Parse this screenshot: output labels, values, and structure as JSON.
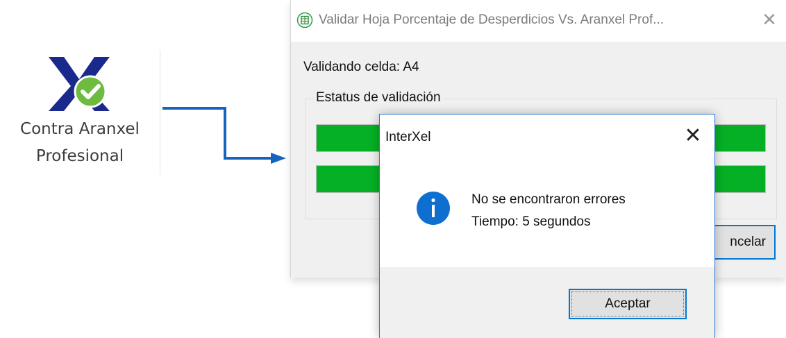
{
  "ribbon": {
    "button_line1": "Contra Aranxel",
    "button_line2": "Profesional",
    "icon": "aranxel-check-logo"
  },
  "validation_window": {
    "title": "Validar Hoja Porcentaje de Desperdicios Vs. Aranxel Prof...",
    "close_symbol": "✕",
    "status_text": "Validando celda: A4",
    "group_title": "Estatus de validación",
    "progress_1": 1.0,
    "progress_2": 1.0,
    "cancel_label": "ncelar"
  },
  "message_box": {
    "title": "InterXel",
    "close_symbol": "✕",
    "icon": "info-icon",
    "line1": "No se encontraron errores",
    "line2": "Tiempo: 5 segundos",
    "ok_label": "Aceptar"
  },
  "colors": {
    "progress_fill": "#06b025",
    "accent_blue": "#0078d7",
    "arrow_blue": "#1565c0",
    "logo_blue": "#1a2a8c",
    "check_green": "#6dbb3f",
    "info_blue": "#0f6fd1"
  }
}
